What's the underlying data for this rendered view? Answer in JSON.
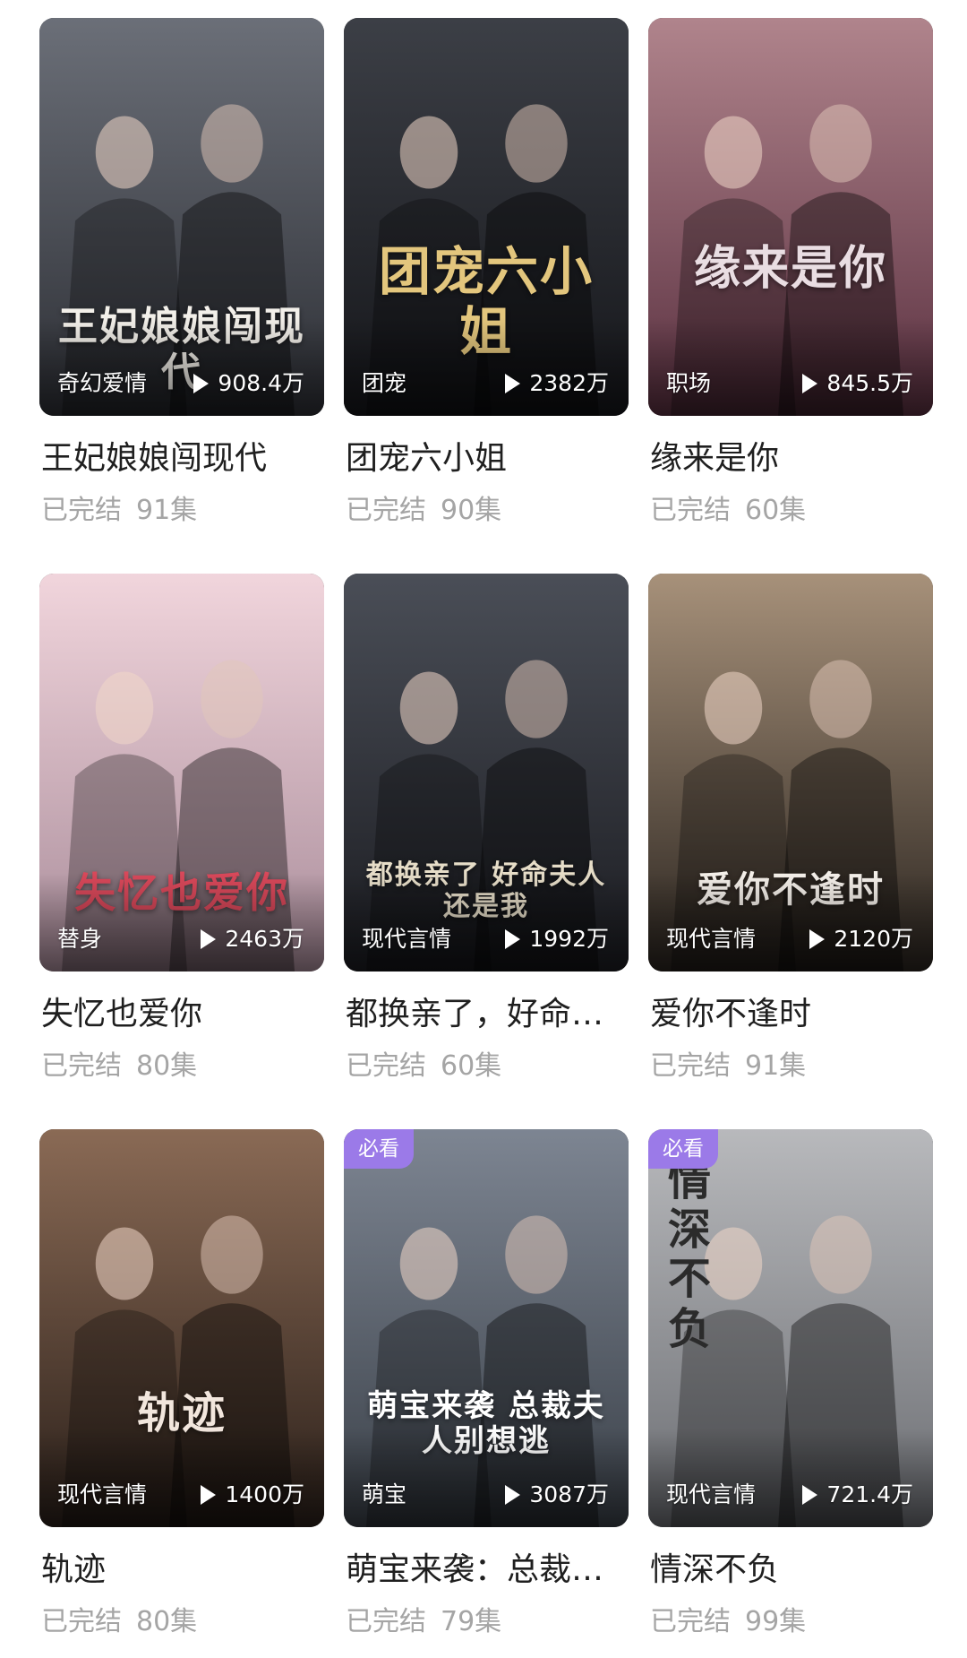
{
  "dramas": [
    {
      "title": "王妃娘娘闯现代",
      "cover_text": "王妃娘娘闯现代",
      "genre": "奇幻爱情",
      "plays": "908.4万",
      "status": "已完结",
      "episodes": "91集",
      "badge": ""
    },
    {
      "title": "团宠六小姐",
      "cover_text": "团宠六小姐",
      "genre": "团宠",
      "plays": "2382万",
      "status": "已完结",
      "episodes": "90集",
      "badge": ""
    },
    {
      "title": "缘来是你",
      "cover_text": "缘来是你",
      "genre": "职场",
      "plays": "845.5万",
      "status": "已完结",
      "episodes": "60集",
      "badge": ""
    },
    {
      "title": "失忆也爱你",
      "cover_text": "失忆也爱你",
      "genre": "替身",
      "plays": "2463万",
      "status": "已完结",
      "episodes": "80集",
      "badge": ""
    },
    {
      "title": "都换亲了，好命夫人还是我",
      "cover_text": "都换亲了 好命夫人还是我",
      "genre": "现代言情",
      "plays": "1992万",
      "status": "已完结",
      "episodes": "60集",
      "badge": ""
    },
    {
      "title": "爱你不逢时",
      "cover_text": "爱你不逢时",
      "genre": "现代言情",
      "plays": "2120万",
      "status": "已完结",
      "episodes": "91集",
      "badge": ""
    },
    {
      "title": "轨迹",
      "cover_text": "轨迹",
      "genre": "现代言情",
      "plays": "1400万",
      "status": "已完结",
      "episodes": "80集",
      "badge": ""
    },
    {
      "title": "萌宝来袭：总裁夫人别想逃",
      "cover_text": "萌宝来袭 总裁夫人别想逃",
      "genre": "萌宝",
      "plays": "3087万",
      "status": "已完结",
      "episodes": "79集",
      "badge": "必看"
    },
    {
      "title": "情深不负",
      "cover_text": "情深不负",
      "genre": "现代言情",
      "plays": "721.4万",
      "status": "已完结",
      "episodes": "99集",
      "badge": "必看"
    }
  ],
  "theme": {
    "cover_colors": [
      [
        "#6b6f78",
        "#2d2f35"
      ],
      [
        "#3c3f46",
        "#15161a"
      ],
      [
        "#b0848c",
        "#5a3040"
      ],
      [
        "#f1d5dc",
        "#a98c9a"
      ],
      [
        "#4a4e57",
        "#1b1c21"
      ],
      [
        "#a7917a",
        "#2a241f"
      ],
      [
        "#8a6a55",
        "#2b201a"
      ],
      [
        "#7d8592",
        "#3a4048"
      ],
      [
        "#b8b9bc",
        "#6b6d72"
      ]
    ],
    "cover_text_colors": [
      "#f3f0ea",
      "#e3c67d",
      "#e9dde2",
      "#d9485a",
      "#e6ddc8",
      "#f5f0ea",
      "#f2e6dd",
      "#ffffff",
      "#2b2b2b"
    ],
    "badge_color": "#9b7ae8",
    "title_color": "#1f1f1f",
    "meta_color": "#a5a5a5"
  }
}
